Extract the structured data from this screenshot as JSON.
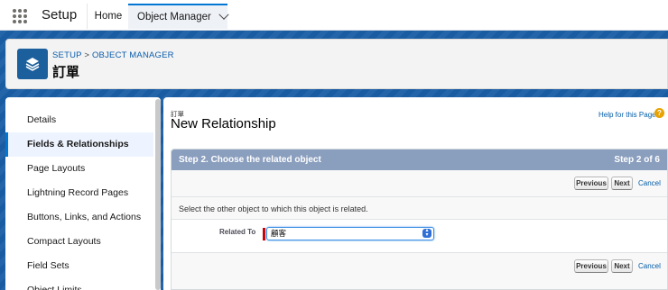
{
  "topnav": {
    "app_name": "Setup",
    "tabs": [
      {
        "label": "Home"
      },
      {
        "label": "Object Manager"
      }
    ]
  },
  "header": {
    "breadcrumb": {
      "setup": "SETUP",
      "separator": ">",
      "object_manager": "OBJECT MANAGER"
    },
    "object_title": "訂單"
  },
  "sidebar": {
    "items": [
      {
        "label": "Details"
      },
      {
        "label": "Fields & Relationships",
        "active": true
      },
      {
        "label": "Page Layouts"
      },
      {
        "label": "Lightning Record Pages"
      },
      {
        "label": "Buttons, Links, and Actions"
      },
      {
        "label": "Compact Layouts"
      },
      {
        "label": "Field Sets"
      },
      {
        "label": "Object Limits"
      }
    ]
  },
  "main": {
    "subtitle": "訂單",
    "title": "New Relationship",
    "help_link": "Help for this Page",
    "help_icon": "?",
    "step": {
      "heading": "Step 2. Choose the related object",
      "progress": "Step 2 of 6"
    },
    "buttons": {
      "previous": "Previous",
      "next": "Next",
      "cancel": "Cancel"
    },
    "instruction": "Select the other object to which this object is related.",
    "related_to": {
      "label": "Related To",
      "value": "顧客"
    }
  },
  "colors": {
    "accent": "#0176d3",
    "band": "#1b5fa6",
    "step_bar": "#8a9ebe",
    "required": "#cc0000"
  }
}
